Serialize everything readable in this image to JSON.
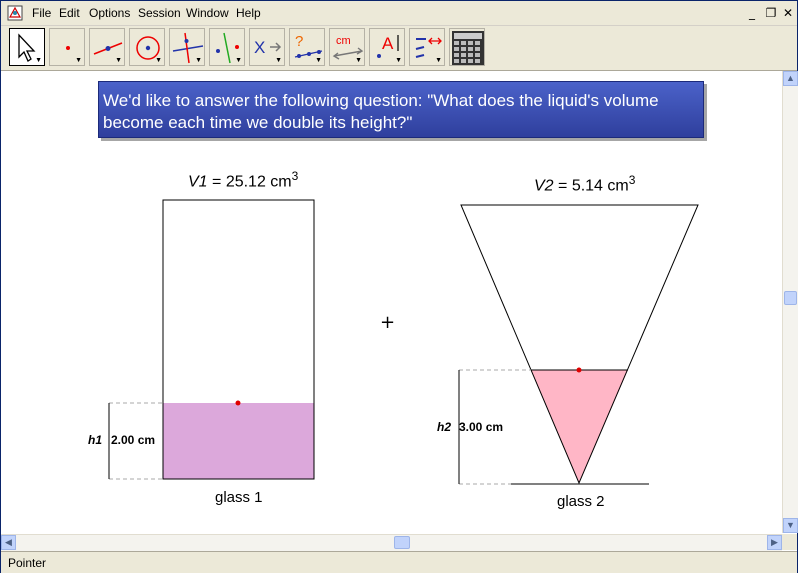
{
  "menu": {
    "items": [
      "File",
      "Edit",
      "Options",
      "Session",
      "Window",
      "Help"
    ]
  },
  "window_controls": {
    "minimize": "_",
    "restore": "❐",
    "close": "✕"
  },
  "toolbar": {
    "tools": [
      {
        "name": "pointer-tool",
        "icon": "arrow-pointer-icon"
      },
      {
        "name": "point-tool",
        "icon": "point-icon"
      },
      {
        "name": "line-tool",
        "icon": "line-icon"
      },
      {
        "name": "circle-tool",
        "icon": "circle-icon"
      },
      {
        "name": "perpendicular-tool",
        "icon": "perpendicular-icon"
      },
      {
        "name": "parallel-tool",
        "icon": "parallel-icon"
      },
      {
        "name": "transform-tool",
        "icon": "transform-icon",
        "text": "X"
      },
      {
        "name": "macro-tool",
        "icon": "macro-icon",
        "text": "?"
      },
      {
        "name": "measure-tool",
        "icon": "measure-icon",
        "text": "cm"
      },
      {
        "name": "text-tool",
        "icon": "text-icon",
        "text": "A"
      },
      {
        "name": "properties-tool",
        "icon": "properties-icon"
      },
      {
        "name": "calculator-tool",
        "icon": "calculator-icon"
      }
    ]
  },
  "banner": {
    "text": "We'd like to answer the following question: \"What does the liquid's volume become each time we double its height?\""
  },
  "glass1": {
    "volume_var": "V1",
    "volume_eq": " =  25.12 cm",
    "volume_exp": "3",
    "height_var": "h1",
    "height_value": "2.00 cm",
    "caption": "glass 1",
    "liquid_fraction": 0.38
  },
  "glass2": {
    "volume_var": "V2",
    "volume_eq": " = 5.14 cm",
    "volume_exp": "3",
    "height_var": "h2",
    "height_value": "3.00 cm",
    "caption": "glass 2"
  },
  "colors": {
    "liquid1": "#dca8db",
    "liquid2": "#ffb6c6",
    "handle": "#e00000",
    "banner": "#3b4fb3"
  },
  "cursor": "+",
  "status": {
    "text": "Pointer"
  }
}
